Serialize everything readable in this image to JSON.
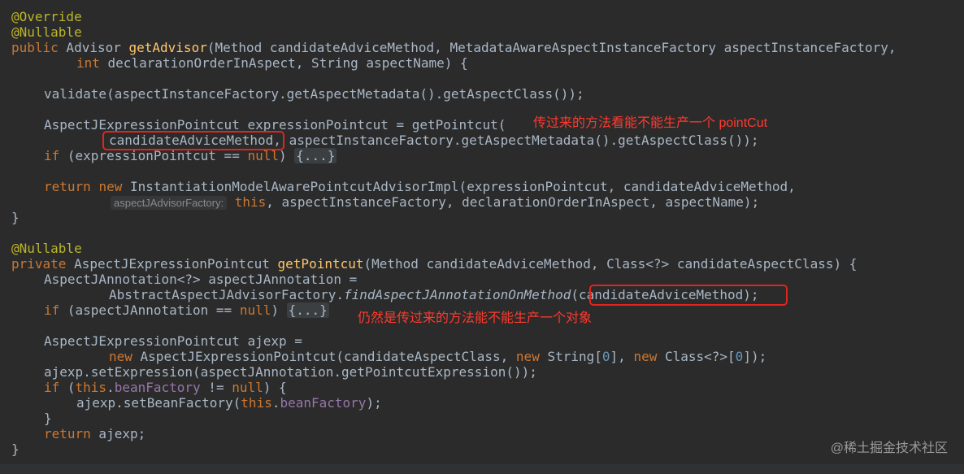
{
  "code": {
    "l1": "@Override",
    "l2": "@Nullable",
    "l3_kw": "public",
    "l3_a": " Advisor ",
    "l3_fn": "getAdvisor",
    "l3_b": "(Method candidateAdviceMethod, MetadataAwareAspectInstanceFactory aspectInstanceFactory,",
    "l4_kw": "int",
    "l4_a": " declarationOrderInAspect, String aspectName) {",
    "l6": "validate(aspectInstanceFactory.getAspectMetadata().getAspectClass());",
    "l8": "AspectJExpressionPointcut expressionPointcut = getPointcut(",
    "l9_boxed": "candidateAdviceMethod",
    "l9_rest": ", aspectInstanceFactory.getAspectMetadata().getAspectClass());",
    "l10_kw": "if",
    "l10_a": " (expressionPointcut == ",
    "l10_null": "null",
    "l10_b": ") ",
    "l10_fold": "{...}",
    "l12_kw1": "return",
    "l12_kw2": "new",
    "l12_a": " InstantiationModelAwarePointcutAdvisorImpl(expressionPointcut, candidateAdviceMethod,",
    "l13_hint": "aspectJAdvisorFactory:",
    "l13_this": "this",
    "l13_a": ", aspectInstanceFactory, declarationOrderInAspect, aspectName);",
    "l14": "}",
    "l16": "@Nullable",
    "l17_kw": "private",
    "l17_a": " AspectJExpressionPointcut ",
    "l17_fn": "getPointcut",
    "l17_b": "(Method candidateAdviceMethod, Class<?> candidateAspectClass) {",
    "l18": "AspectJAnnotation<?> aspectJAnnotation =",
    "l19_a": "AbstractAspectJAdvisorFactory.",
    "l19_it": "findAspectJAnnotationOnMethod",
    "l19_boxed": "(candidateAdviceMethod);",
    "l20_kw": "if",
    "l20_a": " (aspectJAnnotation == ",
    "l20_null": "null",
    "l20_b": ") ",
    "l20_fold": "{...}",
    "l22": "AspectJExpressionPointcut ajexp =",
    "l23_kw1": "new",
    "l23_a": " AspectJExpressionPointcut(candidateAspectClass, ",
    "l23_kw2": "new",
    "l23_b": " String[",
    "l23_n1": "0",
    "l23_c": "], ",
    "l23_kw3": "new",
    "l23_d": " Class<?>[",
    "l23_n2": "0",
    "l23_e": "]);",
    "l24": "ajexp.setExpression(aspectJAnnotation.getPointcutExpression());",
    "l25_kw": "if",
    "l25_a": " (",
    "l25_this": "this",
    "l25_dot": ".",
    "l25_fld": "beanFactory",
    "l25_b": " != ",
    "l25_null": "null",
    "l25_c": ") {",
    "l26_a": "ajexp.setBeanFactory(",
    "l26_this": "this",
    "l26_dot": ".",
    "l26_fld": "beanFactory",
    "l26_b": ");",
    "l27": "}",
    "l28_kw": "return",
    "l28_a": " ajexp;",
    "l29": "}"
  },
  "annotations": {
    "note1": "传过来的方法看能不能生产一个 pointCut",
    "note2": "仍然是传过来的方法能不能生产一个对象"
  },
  "watermark": "@稀土掘金技术社区",
  "colors": {
    "background": "#2b2b2b",
    "keyword": "#cc7832",
    "annotation": "#bbb529",
    "method": "#ffc66d",
    "number": "#6897bb",
    "field": "#9876aa",
    "callout": "#ff3a2e"
  }
}
